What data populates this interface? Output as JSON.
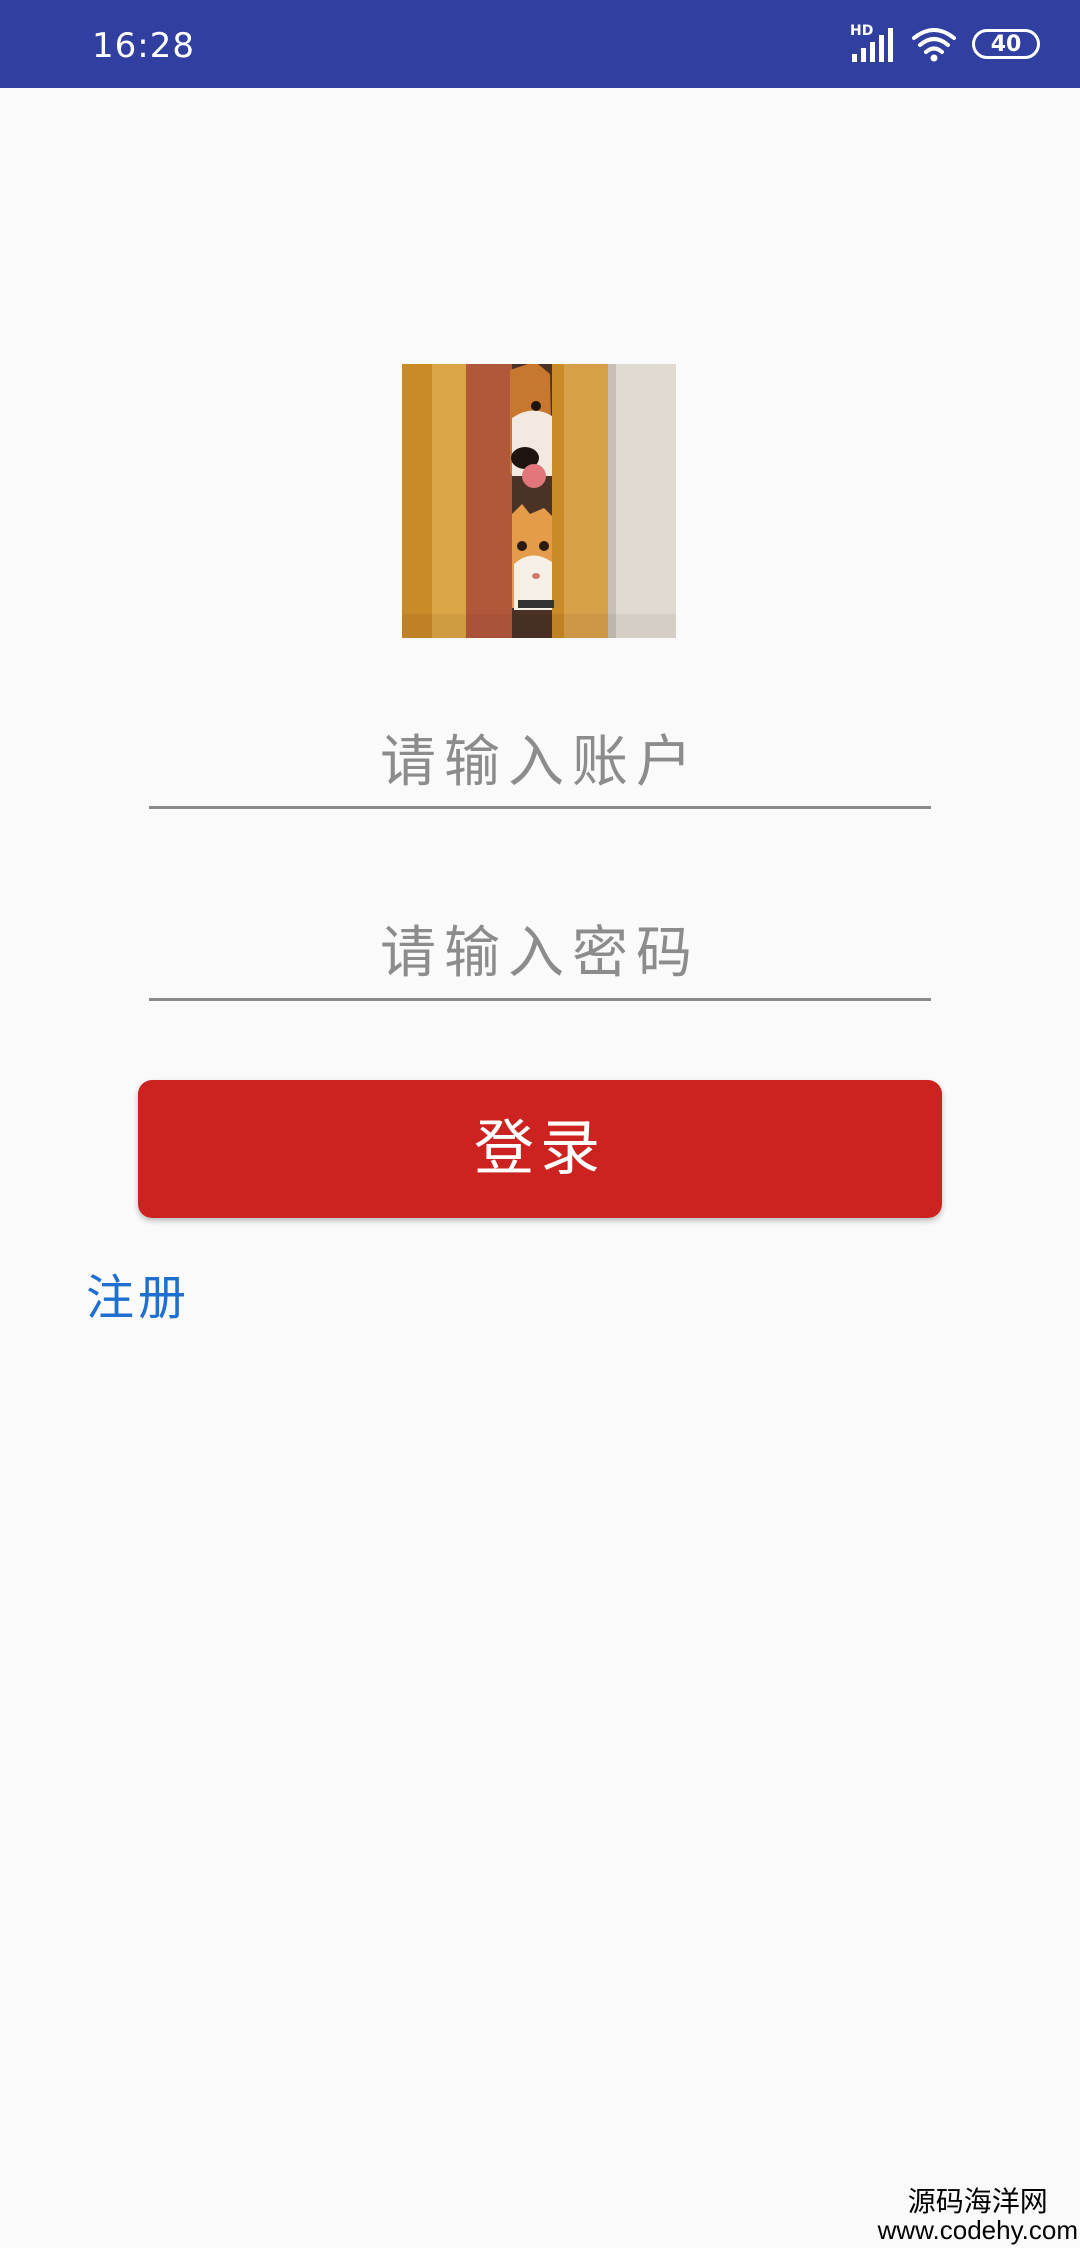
{
  "status_bar": {
    "time": "16:28",
    "network_badge": "HD",
    "battery_level": "40",
    "icons": [
      "signal-icon",
      "wifi-icon",
      "battery-icon"
    ],
    "background_color": "#3140a0"
  },
  "login_form": {
    "logo_icon": "dog-and-cat-peeking-photo",
    "account_placeholder": "请输入账户",
    "password_placeholder": "请输入密码",
    "login_button_label": "登录",
    "login_button_color": "#cc2320",
    "register_link_label": "注册",
    "register_link_color": "#1e6fd0"
  },
  "watermark": {
    "site_name": "源码海洋网",
    "url": "www.codehy.com"
  }
}
